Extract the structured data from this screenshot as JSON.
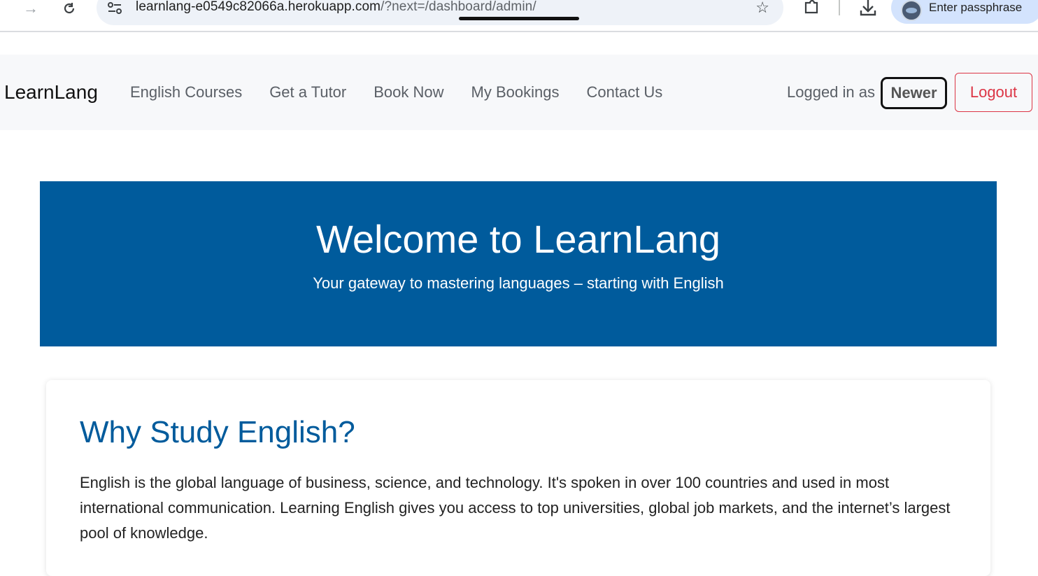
{
  "browser": {
    "url_host": "learnlang-e0549c82066a.herokuapp.com",
    "url_path": "/?next=/dashboard/admin/",
    "profile_label": "Enter passphrase"
  },
  "navbar": {
    "brand": "LearnLang",
    "links": [
      "English Courses",
      "Get a Tutor",
      "Book Now",
      "My Bookings",
      "Contact Us"
    ],
    "logged_in_prefix": "Logged in as",
    "username": "Newer",
    "logout_label": "Logout"
  },
  "hero": {
    "title": "Welcome to LearnLang",
    "subtitle": "Your gateway to mastering languages – starting with English"
  },
  "card": {
    "heading": "Why Study English?",
    "body": "English is the global language of business, science, and technology. It's spoken in over 100 countries and used in most international communication. Learning English gives you access to top universities, global job markets, and the internet’s largest pool of knowledge."
  },
  "colors": {
    "hero_bg": "#005b9c",
    "logout_red": "#dc3545",
    "heading_blue": "#005b9c"
  }
}
